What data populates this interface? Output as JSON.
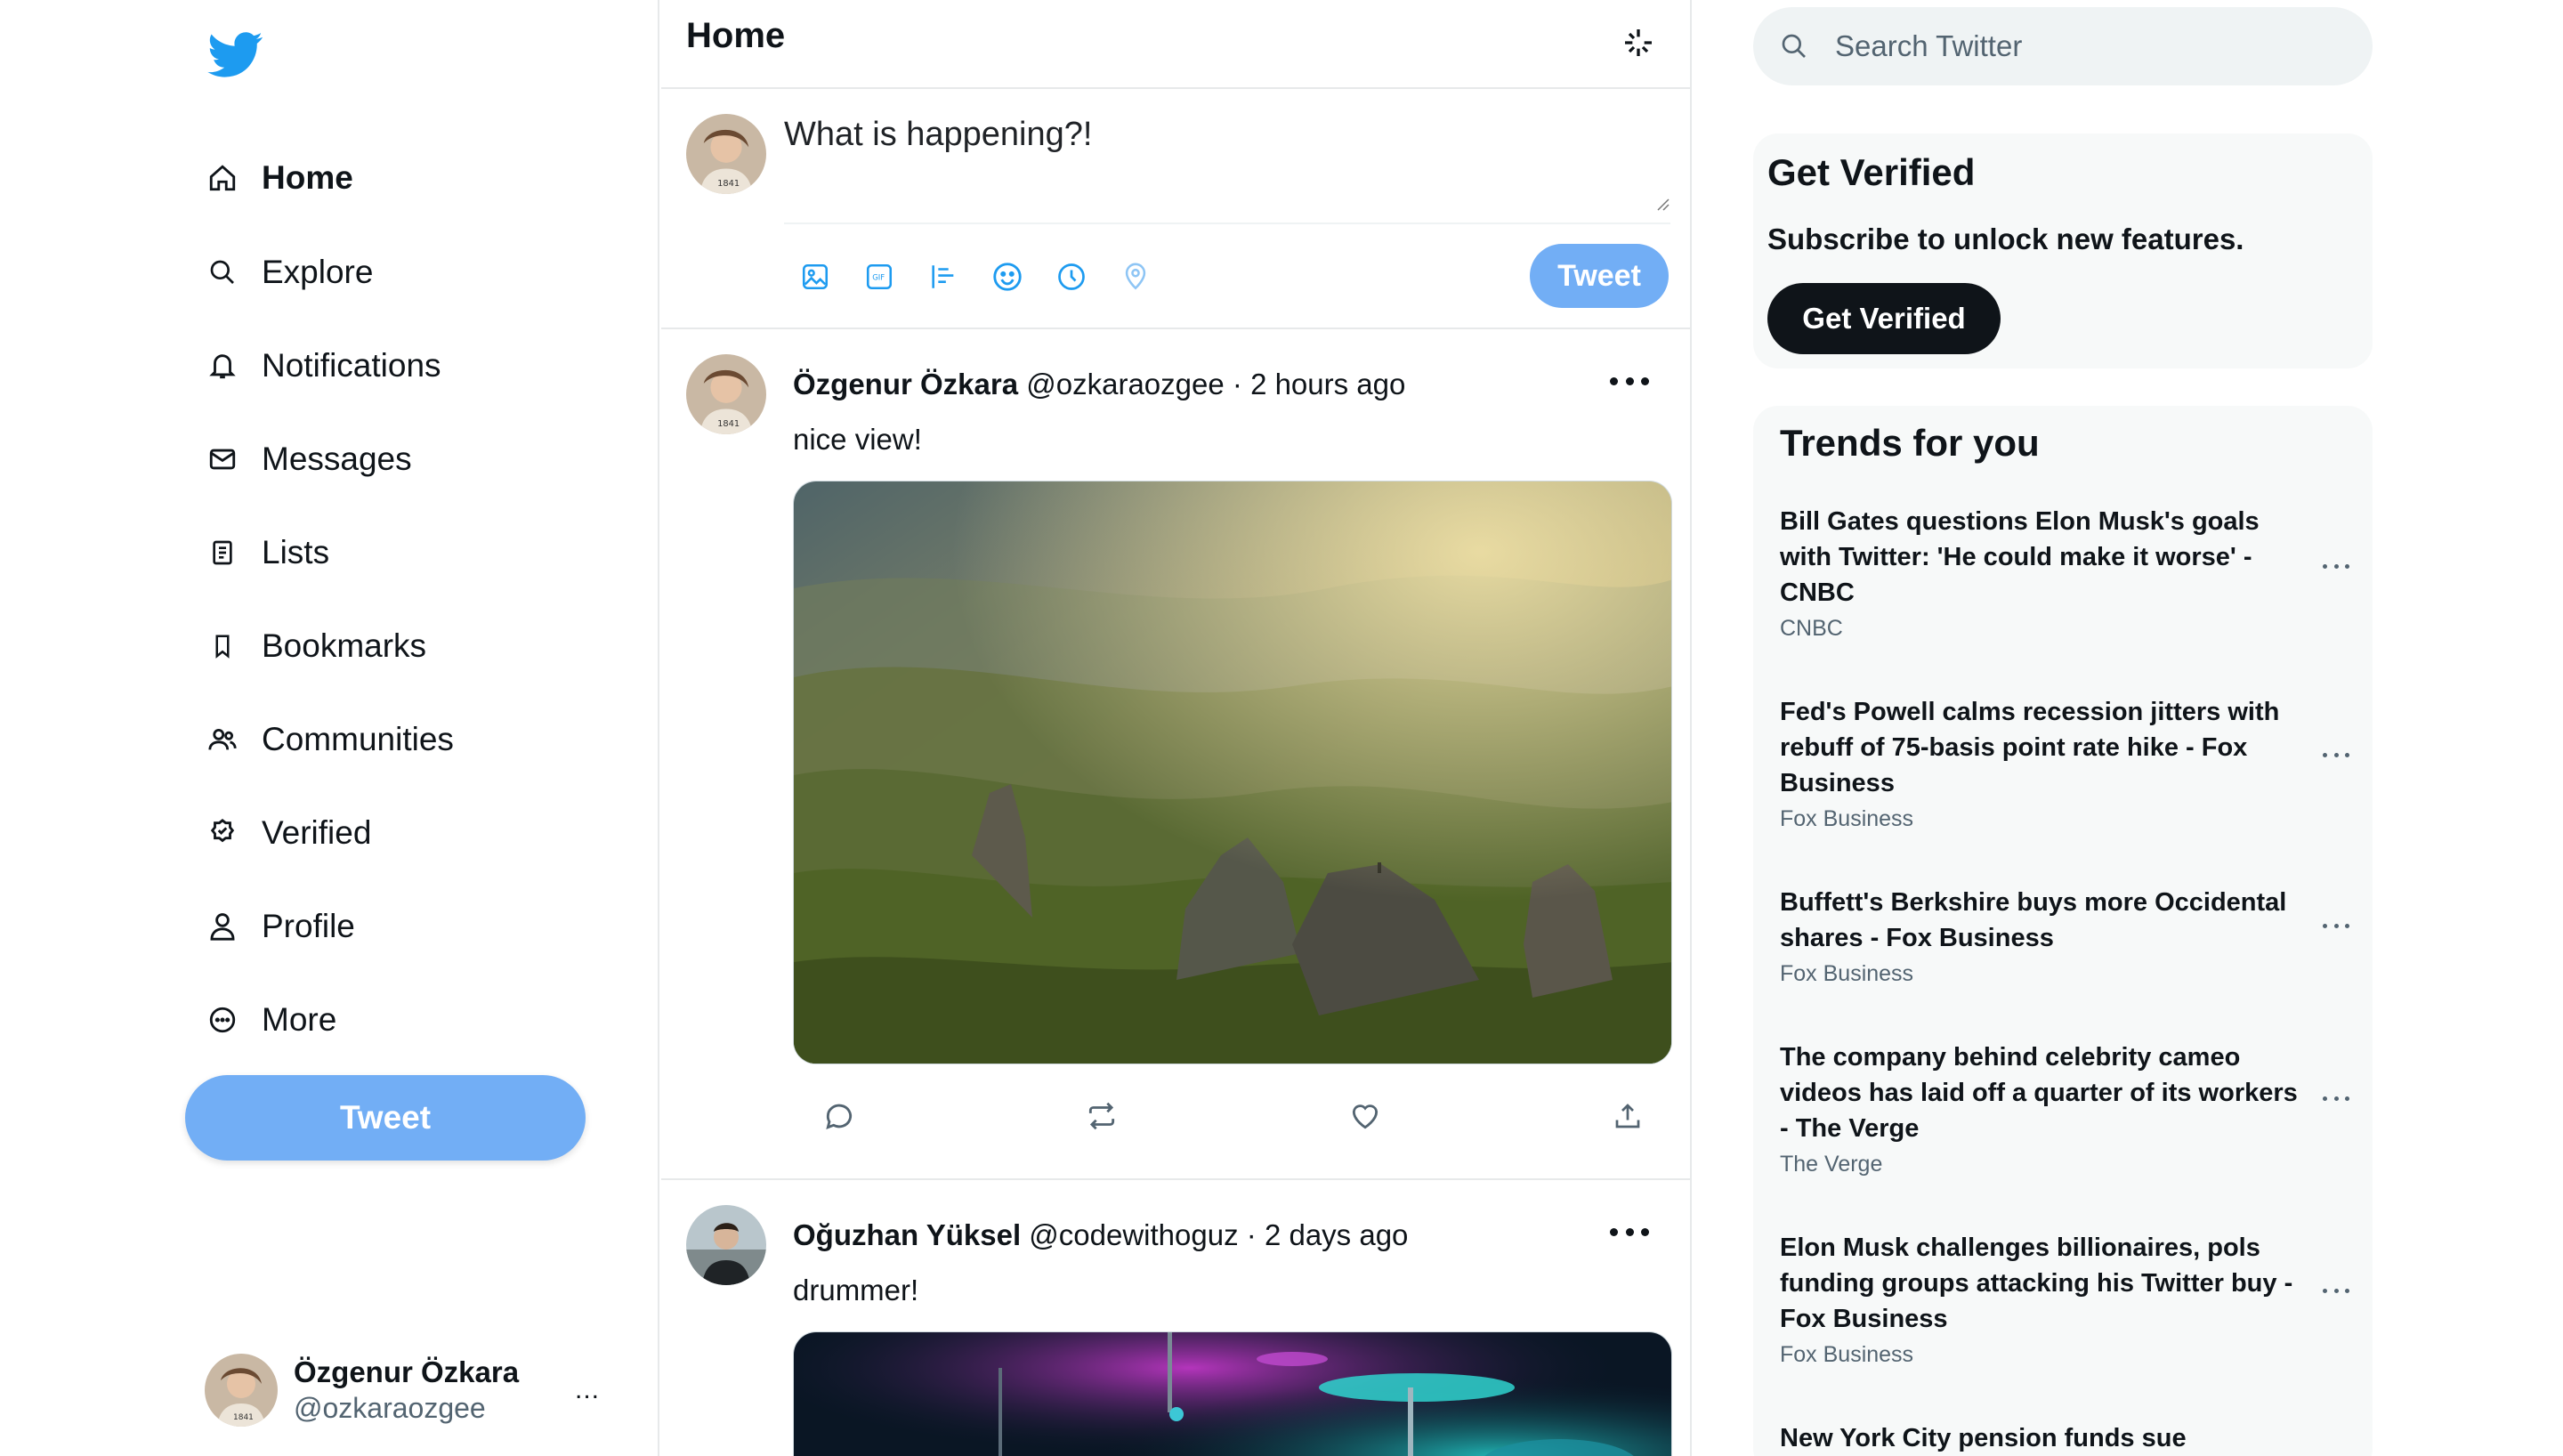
{
  "sidebar": {
    "items": [
      {
        "label": "Home",
        "icon": "home-icon"
      },
      {
        "label": "Explore",
        "icon": "search-icon"
      },
      {
        "label": "Notifications",
        "icon": "bell-icon"
      },
      {
        "label": "Messages",
        "icon": "envelope-icon"
      },
      {
        "label": "Lists",
        "icon": "list-icon"
      },
      {
        "label": "Bookmarks",
        "icon": "bookmark-icon"
      },
      {
        "label": "Communities",
        "icon": "people-icon"
      },
      {
        "label": "Verified",
        "icon": "verified-badge-icon"
      },
      {
        "label": "Profile",
        "icon": "person-icon"
      },
      {
        "label": "More",
        "icon": "more-circle-icon"
      }
    ],
    "tweet_label": "Tweet",
    "account": {
      "name": "Özgenur Özkara",
      "handle": "@ozkaraozgee",
      "more": "..."
    }
  },
  "main": {
    "title": "Home",
    "composer": {
      "placeholder": "What is happening?!",
      "tweet_label": "Tweet"
    },
    "tweets": [
      {
        "name": "Özgenur Özkara",
        "handle": "@ozkaraozgee",
        "time": "2 hours ago",
        "text": "nice view!",
        "image": "mountain-landscape"
      },
      {
        "name": "Oğuzhan Yüksel",
        "handle": "@codewithoguz",
        "time": "2 days ago",
        "text": "drummer!",
        "image": "drum-kit-neon"
      }
    ]
  },
  "right": {
    "search_placeholder": "Search Twitter",
    "verify": {
      "title": "Get Verified",
      "subtitle": "Subscribe to unlock new features.",
      "button": "Get Verified"
    },
    "trends_title": "Trends for you",
    "trends": [
      {
        "title": "Bill Gates questions Elon Musk's goals with Twitter: 'He could make it worse' - CNBC",
        "source": "CNBC"
      },
      {
        "title": "Fed's Powell calms recession jitters with rebuff of 75-basis point rate hike - Fox Business",
        "source": "Fox Business"
      },
      {
        "title": "Buffett's Berkshire buys more Occidental shares - Fox Business",
        "source": "Fox Business"
      },
      {
        "title": "The company behind celebrity cameo videos has laid off a quarter of its workers - The Verge",
        "source": "The Verge"
      },
      {
        "title": "Elon Musk challenges billionaires, pols funding groups attacking his Twitter buy - Fox Business",
        "source": "Fox Business"
      },
      {
        "title": "New York City pension funds sue Activision Blizzard, seeking records",
        "source": ""
      }
    ]
  },
  "colors": {
    "accent": "#1d9bf0",
    "button_light": "#72aef5",
    "text": "#0f1419",
    "muted": "#536471"
  }
}
